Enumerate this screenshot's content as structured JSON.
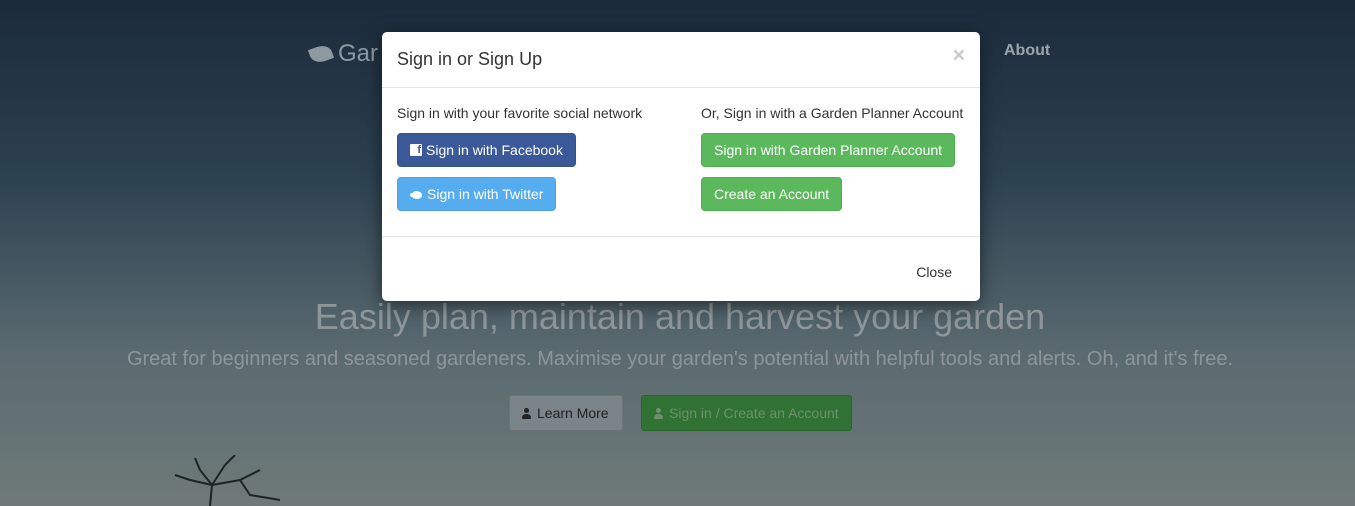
{
  "background": {
    "brand": "Gar",
    "nav_about": "About",
    "hero_title": "Easily plan, maintain and harvest your garden",
    "hero_subtitle": "Great for beginners and seasoned gardeners. Maximise your garden's potential with helpful tools and alerts. Oh, and it's free.",
    "learn_more": "Learn More",
    "signup": "Sign in / Create an Account"
  },
  "modal": {
    "title": "Sign in or Sign Up",
    "close_x": "×",
    "social": {
      "heading": "Sign in with your favorite social network",
      "facebook": "Sign in with Facebook",
      "twitter": "Sign in with Twitter"
    },
    "account": {
      "heading": "Or, Sign in with a Garden Planner Account",
      "signin": "Sign in with Garden Planner Account",
      "create": "Create an Account"
    },
    "footer_close": "Close"
  },
  "colors": {
    "facebook": "#3b5998",
    "twitter": "#55acee",
    "success": "#5cb85c"
  }
}
